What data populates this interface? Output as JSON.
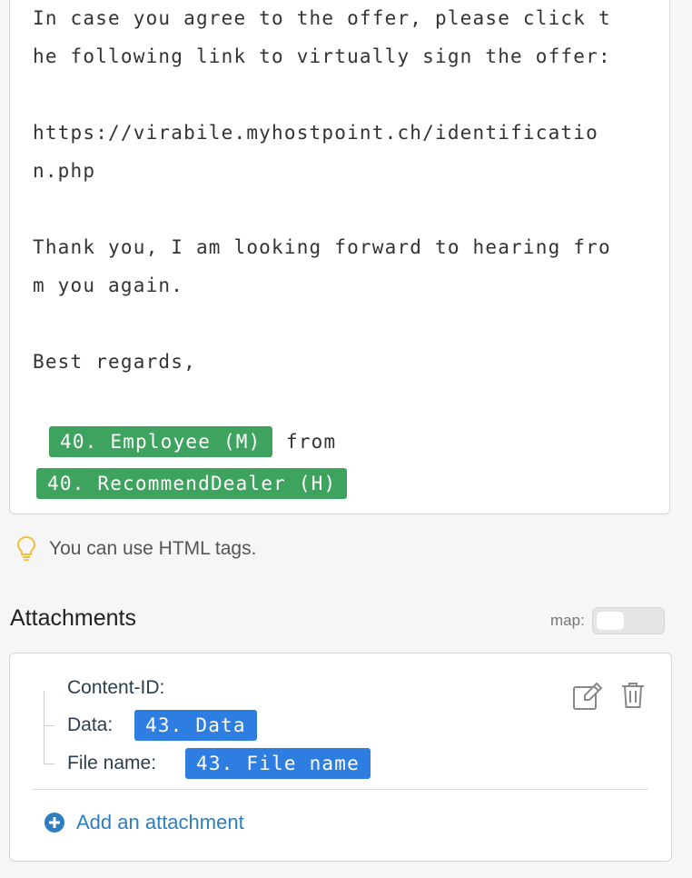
{
  "editor": {
    "lines": [
      "In case you agree to the offer, please click t",
      "he following link to virtually sign the offer:",
      "https://virabile.myhostpoint.ch/identificatio",
      "n.php",
      "Thank you, I am looking forward to hearing fro",
      "m you again.",
      "Best regards,"
    ],
    "tag_employee": "40. Employee (M)",
    "from_text": "from",
    "tag_dealer": "40. RecommendDealer (H)"
  },
  "hint": {
    "text": "You can use HTML tags.",
    "icon": "lightbulb-icon"
  },
  "attachments": {
    "title": "Attachments",
    "map_label": "map:",
    "map_enabled": false,
    "items": [
      {
        "content_id_label": "Content-ID:",
        "data_label": "Data:",
        "data_tag": "43. Data",
        "file_name_label": "File name:",
        "file_name_tag": "43. File name"
      }
    ],
    "add_label": "Add an attachment"
  },
  "colors": {
    "green_tag": "#3ea35f",
    "blue_tag": "#2d7ee0",
    "link": "#2d7ebf"
  }
}
